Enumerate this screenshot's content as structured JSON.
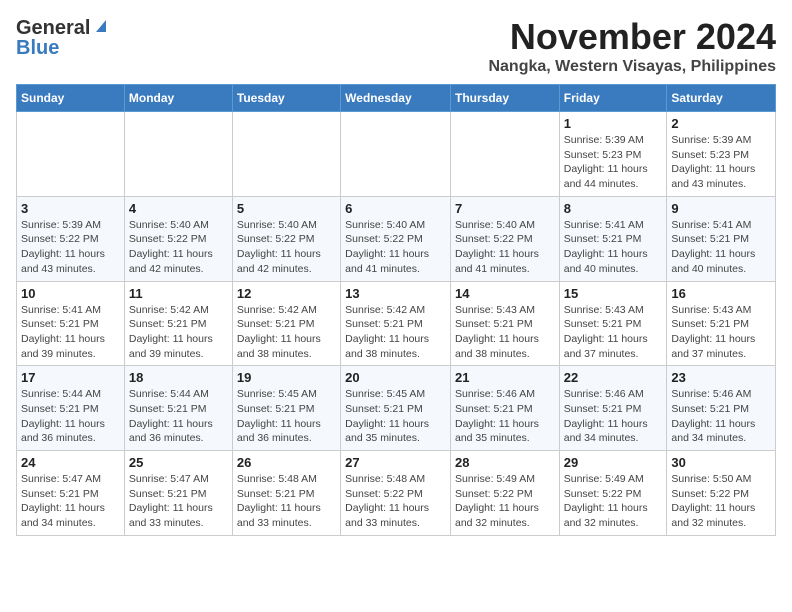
{
  "logo": {
    "general": "General",
    "blue": "Blue"
  },
  "header": {
    "month_year": "November 2024",
    "location": "Nangka, Western Visayas, Philippines"
  },
  "days_of_week": [
    "Sunday",
    "Monday",
    "Tuesday",
    "Wednesday",
    "Thursday",
    "Friday",
    "Saturday"
  ],
  "weeks": [
    [
      {
        "day": "",
        "info": ""
      },
      {
        "day": "",
        "info": ""
      },
      {
        "day": "",
        "info": ""
      },
      {
        "day": "",
        "info": ""
      },
      {
        "day": "",
        "info": ""
      },
      {
        "day": "1",
        "info": "Sunrise: 5:39 AM\nSunset: 5:23 PM\nDaylight: 11 hours and 44 minutes."
      },
      {
        "day": "2",
        "info": "Sunrise: 5:39 AM\nSunset: 5:23 PM\nDaylight: 11 hours and 43 minutes."
      }
    ],
    [
      {
        "day": "3",
        "info": "Sunrise: 5:39 AM\nSunset: 5:22 PM\nDaylight: 11 hours and 43 minutes."
      },
      {
        "day": "4",
        "info": "Sunrise: 5:40 AM\nSunset: 5:22 PM\nDaylight: 11 hours and 42 minutes."
      },
      {
        "day": "5",
        "info": "Sunrise: 5:40 AM\nSunset: 5:22 PM\nDaylight: 11 hours and 42 minutes."
      },
      {
        "day": "6",
        "info": "Sunrise: 5:40 AM\nSunset: 5:22 PM\nDaylight: 11 hours and 41 minutes."
      },
      {
        "day": "7",
        "info": "Sunrise: 5:40 AM\nSunset: 5:22 PM\nDaylight: 11 hours and 41 minutes."
      },
      {
        "day": "8",
        "info": "Sunrise: 5:41 AM\nSunset: 5:21 PM\nDaylight: 11 hours and 40 minutes."
      },
      {
        "day": "9",
        "info": "Sunrise: 5:41 AM\nSunset: 5:21 PM\nDaylight: 11 hours and 40 minutes."
      }
    ],
    [
      {
        "day": "10",
        "info": "Sunrise: 5:41 AM\nSunset: 5:21 PM\nDaylight: 11 hours and 39 minutes."
      },
      {
        "day": "11",
        "info": "Sunrise: 5:42 AM\nSunset: 5:21 PM\nDaylight: 11 hours and 39 minutes."
      },
      {
        "day": "12",
        "info": "Sunrise: 5:42 AM\nSunset: 5:21 PM\nDaylight: 11 hours and 38 minutes."
      },
      {
        "day": "13",
        "info": "Sunrise: 5:42 AM\nSunset: 5:21 PM\nDaylight: 11 hours and 38 minutes."
      },
      {
        "day": "14",
        "info": "Sunrise: 5:43 AM\nSunset: 5:21 PM\nDaylight: 11 hours and 38 minutes."
      },
      {
        "day": "15",
        "info": "Sunrise: 5:43 AM\nSunset: 5:21 PM\nDaylight: 11 hours and 37 minutes."
      },
      {
        "day": "16",
        "info": "Sunrise: 5:43 AM\nSunset: 5:21 PM\nDaylight: 11 hours and 37 minutes."
      }
    ],
    [
      {
        "day": "17",
        "info": "Sunrise: 5:44 AM\nSunset: 5:21 PM\nDaylight: 11 hours and 36 minutes."
      },
      {
        "day": "18",
        "info": "Sunrise: 5:44 AM\nSunset: 5:21 PM\nDaylight: 11 hours and 36 minutes."
      },
      {
        "day": "19",
        "info": "Sunrise: 5:45 AM\nSunset: 5:21 PM\nDaylight: 11 hours and 36 minutes."
      },
      {
        "day": "20",
        "info": "Sunrise: 5:45 AM\nSunset: 5:21 PM\nDaylight: 11 hours and 35 minutes."
      },
      {
        "day": "21",
        "info": "Sunrise: 5:46 AM\nSunset: 5:21 PM\nDaylight: 11 hours and 35 minutes."
      },
      {
        "day": "22",
        "info": "Sunrise: 5:46 AM\nSunset: 5:21 PM\nDaylight: 11 hours and 34 minutes."
      },
      {
        "day": "23",
        "info": "Sunrise: 5:46 AM\nSunset: 5:21 PM\nDaylight: 11 hours and 34 minutes."
      }
    ],
    [
      {
        "day": "24",
        "info": "Sunrise: 5:47 AM\nSunset: 5:21 PM\nDaylight: 11 hours and 34 minutes."
      },
      {
        "day": "25",
        "info": "Sunrise: 5:47 AM\nSunset: 5:21 PM\nDaylight: 11 hours and 33 minutes."
      },
      {
        "day": "26",
        "info": "Sunrise: 5:48 AM\nSunset: 5:21 PM\nDaylight: 11 hours and 33 minutes."
      },
      {
        "day": "27",
        "info": "Sunrise: 5:48 AM\nSunset: 5:22 PM\nDaylight: 11 hours and 33 minutes."
      },
      {
        "day": "28",
        "info": "Sunrise: 5:49 AM\nSunset: 5:22 PM\nDaylight: 11 hours and 32 minutes."
      },
      {
        "day": "29",
        "info": "Sunrise: 5:49 AM\nSunset: 5:22 PM\nDaylight: 11 hours and 32 minutes."
      },
      {
        "day": "30",
        "info": "Sunrise: 5:50 AM\nSunset: 5:22 PM\nDaylight: 11 hours and 32 minutes."
      }
    ]
  ]
}
